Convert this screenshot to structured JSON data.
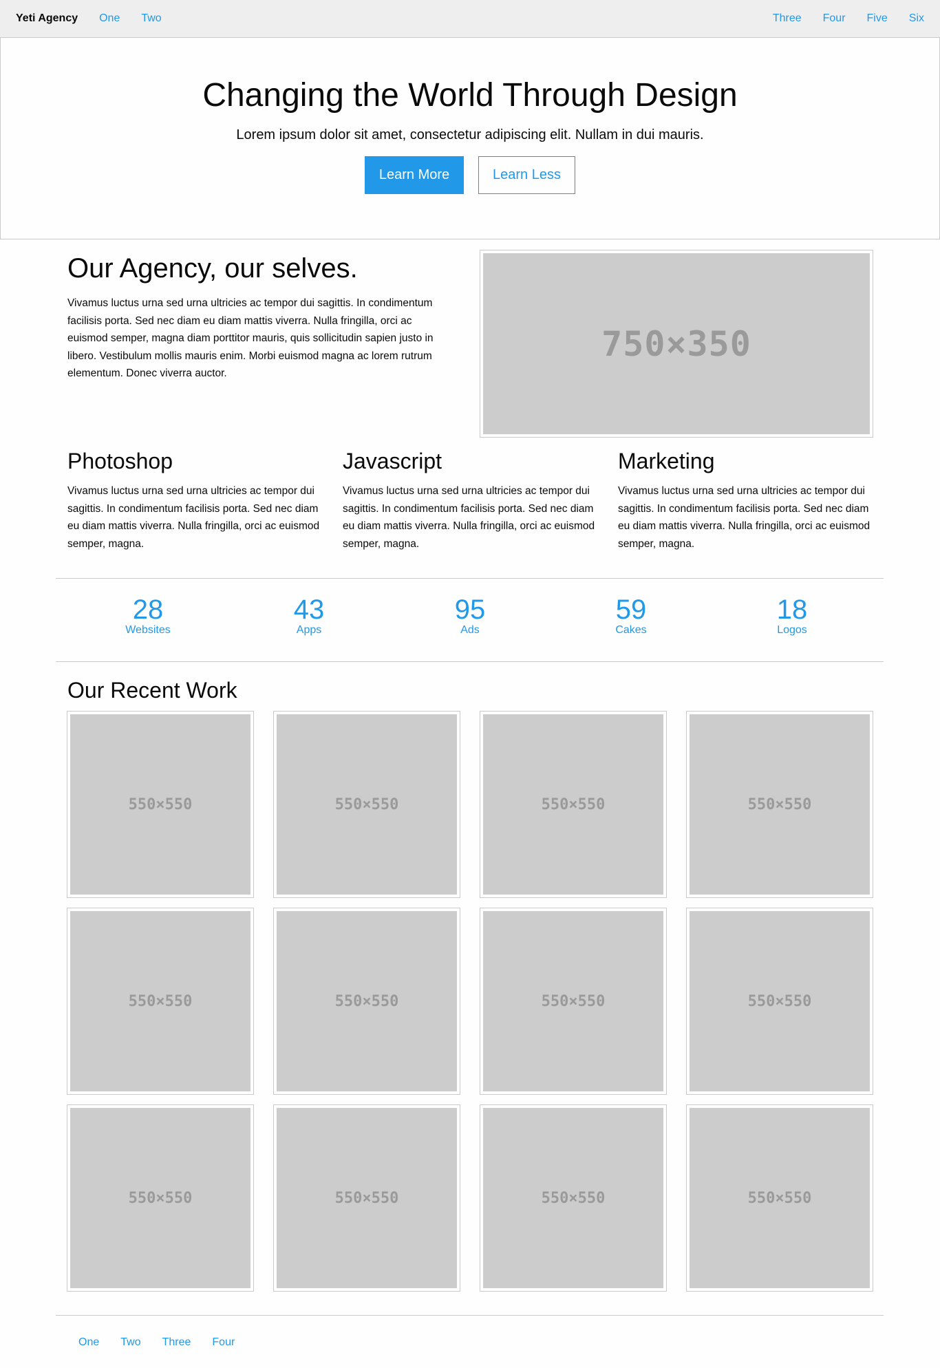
{
  "topbar": {
    "brand": "Yeti Agency",
    "left_links": [
      "One",
      "Two"
    ],
    "right_links": [
      "Three",
      "Four",
      "Five",
      "Six"
    ]
  },
  "hero": {
    "title": "Changing the World Through Design",
    "subtitle": "Lorem ipsum dolor sit amet, consectetur adipiscing elit. Nullam in dui mauris.",
    "primary_button": "Learn More",
    "secondary_button": "Learn Less"
  },
  "agency": {
    "title": "Our Agency, our selves.",
    "text": "Vivamus luctus urna sed urna ultricies ac tempor dui sagittis. In condimentum facilisis porta. Sed nec diam eu diam mattis viverra. Nulla fringilla, orci ac euismod semper, magna diam porttitor mauris, quis sollicitudin sapien justo in libero. Vestibulum mollis mauris enim. Morbi euismod magna ac lorem rutrum elementum. Donec viverra auctor.",
    "image_label": "750×350"
  },
  "services": [
    {
      "title": "Photoshop",
      "text": "Vivamus luctus urna sed urna ultricies ac tempor dui sagittis. In condimentum facilisis porta. Sed nec diam eu diam mattis viverra. Nulla fringilla, orci ac euismod semper, magna."
    },
    {
      "title": "Javascript",
      "text": "Vivamus luctus urna sed urna ultricies ac tempor dui sagittis. In condimentum facilisis porta. Sed nec diam eu diam mattis viverra. Nulla fringilla, orci ac euismod semper, magna."
    },
    {
      "title": "Marketing",
      "text": "Vivamus luctus urna sed urna ultricies ac tempor dui sagittis. In condimentum facilisis porta. Sed nec diam eu diam mattis viverra. Nulla fringilla, orci ac euismod semper, magna."
    }
  ],
  "stats": [
    {
      "value": "28",
      "label": "Websites"
    },
    {
      "value": "43",
      "label": "Apps"
    },
    {
      "value": "95",
      "label": "Ads"
    },
    {
      "value": "59",
      "label": "Cakes"
    },
    {
      "value": "18",
      "label": "Logos"
    }
  ],
  "work": {
    "title": "Our Recent Work",
    "items": [
      "550×550",
      "550×550",
      "550×550",
      "550×550",
      "550×550",
      "550×550",
      "550×550",
      "550×550",
      "550×550",
      "550×550",
      "550×550",
      "550×550"
    ]
  },
  "footer": {
    "links": [
      "One",
      "Two",
      "Three",
      "Four"
    ]
  },
  "colors": {
    "accent": "#2199e8",
    "topbar_bg": "#eeeeee",
    "placeholder_bg": "#cccccc",
    "border": "#cacaca"
  }
}
